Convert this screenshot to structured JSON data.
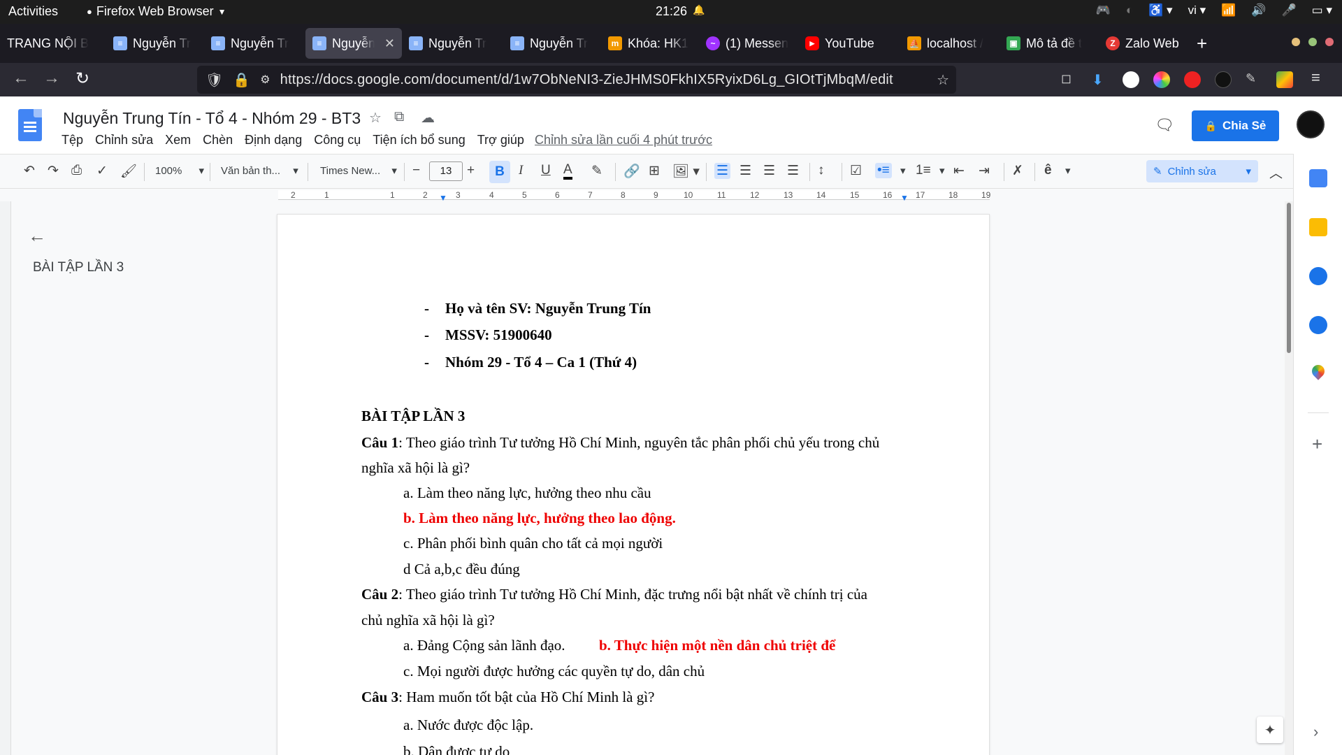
{
  "gnome": {
    "activities": "Activities",
    "app_name": "Firefox Web Browser",
    "clock": "21:26",
    "language": "vi"
  },
  "tabs": [
    {
      "label": "TRANG NỘI B",
      "icon_color": "",
      "icon": "none"
    },
    {
      "label": "Nguyễn Tr",
      "icon_color": "#8ab4f8",
      "icon": "docs-icon"
    },
    {
      "label": "Nguyễn Tr",
      "icon_color": "#8ab4f8",
      "icon": "docs-icon"
    },
    {
      "label": "Nguyễn",
      "icon_color": "#8ab4f8",
      "icon": "docs-icon",
      "active": true
    },
    {
      "label": "Nguyễn Tr",
      "icon_color": "#8ab4f8",
      "icon": "docs-icon"
    },
    {
      "label": "Nguyễn Tr",
      "icon_color": "#8ab4f8",
      "icon": "docs-icon"
    },
    {
      "label": "Khóa: HK1",
      "icon_color": "#f29900",
      "icon": "moodle-icon"
    },
    {
      "label": "(1) Messen",
      "icon_color": "#a033ff",
      "icon": "messenger-icon"
    },
    {
      "label": "YouTube",
      "icon_color": "#ff0000",
      "icon": "youtube-icon"
    },
    {
      "label": "localhost /",
      "icon_color": "#f29900",
      "icon": "phpmyadmin-icon"
    },
    {
      "label": "Mô tả đề t",
      "icon_color": "#34a853",
      "icon": "classroom-icon"
    },
    {
      "label": "Zalo Web",
      "icon_color": "#e53935",
      "icon": "zalo-icon"
    }
  ],
  "nav": {
    "url": "https://docs.google.com/document/d/1w7ObNeNI3-ZieJHMS0FkhIX5RyixD6Lg_GIOtTjMbqM/edit"
  },
  "doc": {
    "title": "Nguyễn Trung Tín - Tổ 4 - Nhóm 29 - BT3",
    "menus": [
      "Tệp",
      "Chỉnh sửa",
      "Xem",
      "Chèn",
      "Định dạng",
      "Công cụ",
      "Tiện ích bổ sung",
      "Trợ giúp"
    ],
    "last_edit": "Chỉnh sửa lần cuối 4 phút trước",
    "share": "Chia Sẻ"
  },
  "toolbar": {
    "zoom": "100%",
    "style": "Văn bản th...",
    "font": "Times New...",
    "font_size": "13",
    "mode": "Chỉnh sửa"
  },
  "ruler": [
    "2",
    "1",
    "1",
    "2",
    "3",
    "4",
    "5",
    "6",
    "7",
    "8",
    "9",
    "10",
    "11",
    "12",
    "13",
    "14",
    "15",
    "16",
    "17",
    "18",
    "19"
  ],
  "outline": {
    "item": "BÀI TẬP LẦN 3"
  },
  "content": {
    "info": [
      "Họ và tên SV: Nguyễn Trung Tín",
      "MSSV: 51900640",
      "Nhóm 29 - Tổ 4 – Ca 1 (Thứ 4)"
    ],
    "heading": "BÀI TẬP LẦN 3",
    "q1_label": "Câu 1",
    "q1_text": ": Theo giáo trình Tư tưởng Hồ Chí Minh, nguyên tắc phân phối chủ yếu trong chủ",
    "q1_text2": "nghĩa xã hội là gì?",
    "q1_options": [
      "a. Làm theo năng lực, hưởng theo nhu cầu",
      "b. Làm theo năng lực, hưởng theo lao động.",
      "c. Phân phối bình quân cho tất cả mọi người",
      "d Cả a,b,c đều đúng"
    ],
    "q2_label": "Câu 2",
    "q2_text": ": Theo giáo trình Tư tưởng Hồ Chí Minh, đặc trưng nổi bật nhất về chính trị của",
    "q2_text2": "chủ nghĩa xã hội là gì?",
    "q2_option_a": "a. Đảng Cộng sản lãnh đạo.",
    "q2_option_b": "b. Thực hiện một nền dân chủ triệt để",
    "q2_option_c": "c. Mọi người được hưởng các quyền tự do, dân chủ",
    "q3_label": "Câu 3",
    "q3_text": ":  Ham muốn tốt bật của Hồ Chí Minh là gì?",
    "q3_option_a": "a. Nước được độc lập.",
    "q3_option_b": "b. Dân được tự do"
  }
}
